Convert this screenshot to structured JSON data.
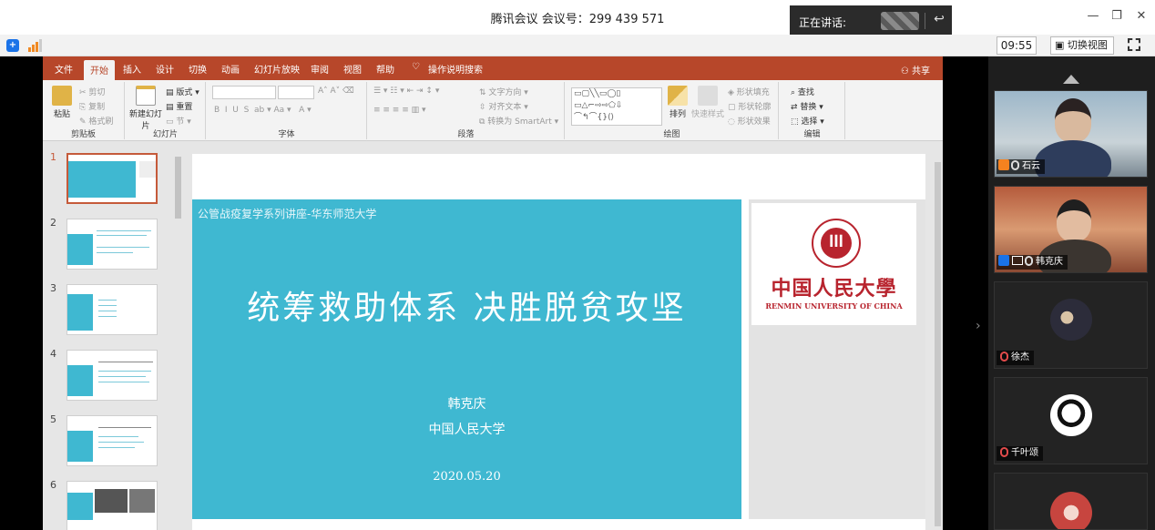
{
  "window": {
    "title": "腾讯会议 会议号：299 439 571",
    "speaking_label": "正在讲话:",
    "time": "09:55",
    "switch_view": "切换视图"
  },
  "ppt": {
    "tabs": [
      "文件",
      "开始",
      "插入",
      "设计",
      "切换",
      "动画",
      "幻灯片放映",
      "审阅",
      "视图",
      "帮助",
      "操作说明搜索"
    ],
    "active_tab": "开始",
    "share": "共享",
    "groups": {
      "clipboard": {
        "name": "剪贴板",
        "paste": "粘贴",
        "cut": "剪切",
        "copy": "复制",
        "format_painter": "格式刷"
      },
      "slides": {
        "name": "幻灯片",
        "new_slide": "新建幻灯片",
        "layout": "版式",
        "reset": "重置",
        "section": "节"
      },
      "font": {
        "name": "字体"
      },
      "paragraph": {
        "name": "段落",
        "text_direction": "文字方向",
        "align_text": "对齐文本",
        "smartart": "转换为 SmartArt"
      },
      "drawing": {
        "name": "绘图",
        "arrange": "排列",
        "quick_styles": "快速样式",
        "shape_fill": "形状填充",
        "shape_outline": "形状轮廓",
        "shape_effects": "形状效果"
      },
      "editing": {
        "name": "编辑",
        "find": "查找",
        "replace": "替换",
        "select": "选择"
      }
    },
    "thumbnails": [
      "1",
      "2",
      "3",
      "4",
      "5",
      "6"
    ],
    "slide": {
      "subtitle": "公管战疫复学系列讲座-华东师范大学",
      "title": "统筹救助体系 决胜脱贫攻坚",
      "author": "韩克庆",
      "org": "中国人民大学",
      "date": "2020.05.20",
      "logo_cn": "中国人民大學",
      "logo_en": "RENMIN UNIVERSITY OF CHINA"
    }
  },
  "participants": [
    {
      "name": "石云",
      "video": true
    },
    {
      "name": "韩克庆",
      "video": true
    },
    {
      "name": "徐杰",
      "video": false
    },
    {
      "name": "千叶颂",
      "video": false
    }
  ],
  "colors": {
    "ppt_accent": "#b7472a",
    "slide_teal": "#3fb8d1",
    "logo_red": "#b8242e"
  }
}
